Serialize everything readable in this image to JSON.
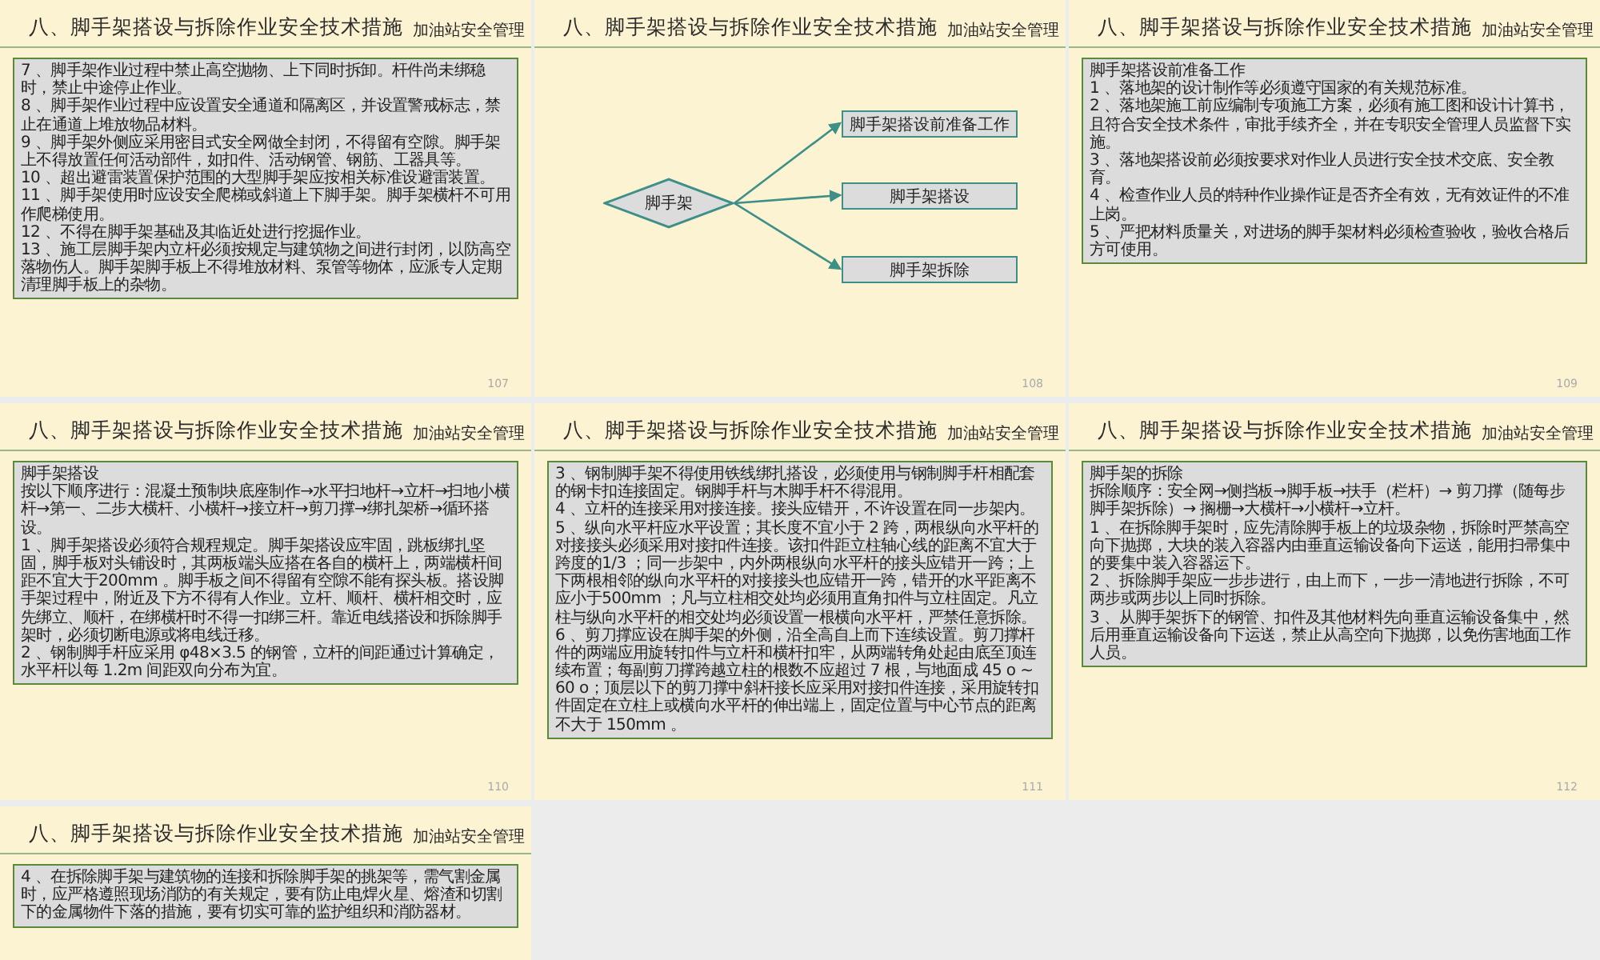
{
  "slides": [
    {
      "kind": "text",
      "title": "八、脚手架搭设与拆除作业安全技术措施",
      "subtitle": "加油站安全管理",
      "number": "107",
      "paragraphs": [
        "7 、脚手架作业过程中禁止高空抛物、上下同时拆卸。杆件尚未绑稳时，禁止中途停止作业。",
        "8 、脚手架作业过程中应设置安全通道和隔离区，并设置警戒标志，禁止在通道上堆放物品材料。",
        "9 、脚手架外侧应采用密目式安全网做全封闭，不得留有空隙。脚手架上不得放置任何活动部件，如扣件、活动钢管、钢筋、工器具等。",
        "10 、超出避雷装置保护范围的大型脚手架应按相关标准设避雷装置。",
        "11 、脚手架使用时应设安全爬梯或斜道上下脚手架。脚手架横杆不可用作爬梯使用。",
        "12 、不得在脚手架基础及其临近处进行挖掘作业。",
        "13 、施工层脚手架内立杆必须按规定与建筑物之间进行封闭，以防高空落物伤人。脚手架脚手板上不得堆放材料、泵管等物体，应派专人定期清理脚手板上的杂物。"
      ]
    },
    {
      "kind": "diagram",
      "title": "八、脚手架搭设与拆除作业安全技术措施",
      "subtitle": "加油站安全管理",
      "number": "108",
      "root": "脚手架",
      "branches": [
        "脚手架搭设前准备工作",
        "脚手架搭设",
        "脚手架拆除"
      ]
    },
    {
      "kind": "text",
      "title": "八、脚手架搭设与拆除作业安全技术措施",
      "subtitle": "加油站安全管理",
      "number": "109",
      "paragraphs": [
        "脚手架搭设前准备工作",
        "1 、落地架的设计制作等必须遵守国家的有关规范标准。",
        "2 、落地架施工前应编制专项施工方案，必须有施工图和设计计算书，且符合安全技术条件，审批手续齐全，并在专职安全管理人员监督下实施。",
        "3 、落地架搭设前必须按要求对作业人员进行安全技术交底、安全教育。",
        "4 、检查作业人员的特种作业操作证是否齐全有效，无有效证件的不准上岗。",
        "5 、严把材料质量关，对进场的脚手架材料必须检查验收，验收合格后方可使用。"
      ]
    },
    {
      "kind": "text",
      "title": "八、脚手架搭设与拆除作业安全技术措施",
      "subtitle": "加油站安全管理",
      "number": "110",
      "paragraphs": [
        "脚手架搭设",
        "按以下顺序进行：混凝土预制块底座制作→水平扫地杆→立杆→扫地小横杆→第一、二步大横杆、小横杆→接立杆→剪刀撑→绑扎架桥→循环搭设。",
        "1 、脚手架搭设必须符合规程规定。脚手架搭设应牢固，跳板绑扎坚固，脚手板对头铺设时，其两板端头应搭在各自的横杆上，两端横杆间距不宜大于200mm 。脚手板之间不得留有空隙不能有探头板。搭设脚手架过程中，附近及下方不得有人作业。立杆、顺杆、横杆相交时，应先绑立、顺杆，在绑横杆时不得一扣绑三杆。靠近电线搭设和拆除脚手架时，必须切断电源或将电线迁移。",
        "2 、钢制脚手杆应采用 φ48×3.5 的钢管，立杆的间距通过计算确定，水平杆以每 1.2m 间距双向分布为宜。"
      ]
    },
    {
      "kind": "text",
      "title": "八、脚手架搭设与拆除作业安全技术措施",
      "subtitle": "加油站安全管理",
      "number": "111",
      "paragraphs": [
        "3 、钢制脚手架不得使用铁线绑扎搭设，必须使用与钢制脚手杆相配套的钢卡扣连接固定。钢脚手杆与木脚手杆不得混用。",
        "4 、立杆的连接采用对接连接。接头应错开，不许设置在同一步架内。",
        "5 、纵向水平杆应水平设置；其长度不宜小于 2 跨，两根纵向水平杆的对接接头必须采用对接扣件连接。该扣件距立柱轴心线的距离不宜大于跨度的1/3 ；同一步架中，内外两根纵向水平杆的接头应错开一跨；上下两根相邻的纵向水平杆的对接接头也应错开一跨，错开的水平距离不应小于500mm ；凡与立柱相交处均必须用直角扣件与立柱固定。凡立柱与纵向水平杆的相交处均必须设置一根横向水平杆，严禁任意拆除。",
        "6 、剪刀撑应设在脚手架的外侧，沿全高自上而下连续设置。剪刀撑杆件的两端应用旋转扣件与立杆和横杆扣牢，从两端转角处起由底至顶连续布置；每副剪刀撑跨越立柱的根数不应超过 7 根，与地面成 45 o ~ 60 o；顶层以下的剪刀撑中斜杆接长应采用对接扣件连接，采用旋转扣件固定在立柱上或横向水平杆的伸出端上，固定位置与中心节点的距离不大于 150mm 。"
      ]
    },
    {
      "kind": "text",
      "title": "八、脚手架搭设与拆除作业安全技术措施",
      "subtitle": "加油站安全管理",
      "number": "112",
      "paragraphs": [
        "脚手架的拆除",
        "拆除顺序：安全网→侧挡板→脚手板→扶手（栏杆）→ 剪刀撑（随每步脚手架拆除）→ 搁栅→大横杆→小横杆→立杆。",
        "1 、在拆除脚手架时，应先清除脚手板上的垃圾杂物，拆除时严禁高空向下抛掷，大块的装入容器内由垂直运输设备向下运送，能用扫帚集中的要集中装入容器运下。",
        "2 、拆除脚手架应一步步进行，由上而下，一步一清地进行拆除，不可两步或两步以上同时拆除。",
        "3 、从脚手架拆下的钢管、扣件及其他材料先向垂直运输设备集中，然后用垂直运输设备向下运送，禁止从高空向下抛掷，以免伤害地面工作人员。"
      ]
    },
    {
      "kind": "text",
      "title": "八、脚手架搭设与拆除作业安全技术措施",
      "subtitle": "加油站安全管理",
      "paragraphs": [
        "4 、在拆除脚手架与建筑物的连接和拆除脚手架的挑架等，需气割金属时，应严格遵照现场消防的有关规定，要有防止电焊火星、熔渣和切割下的金属物件下落的措施，要有切实可靠的监护组织和消防器材。"
      ]
    }
  ]
}
